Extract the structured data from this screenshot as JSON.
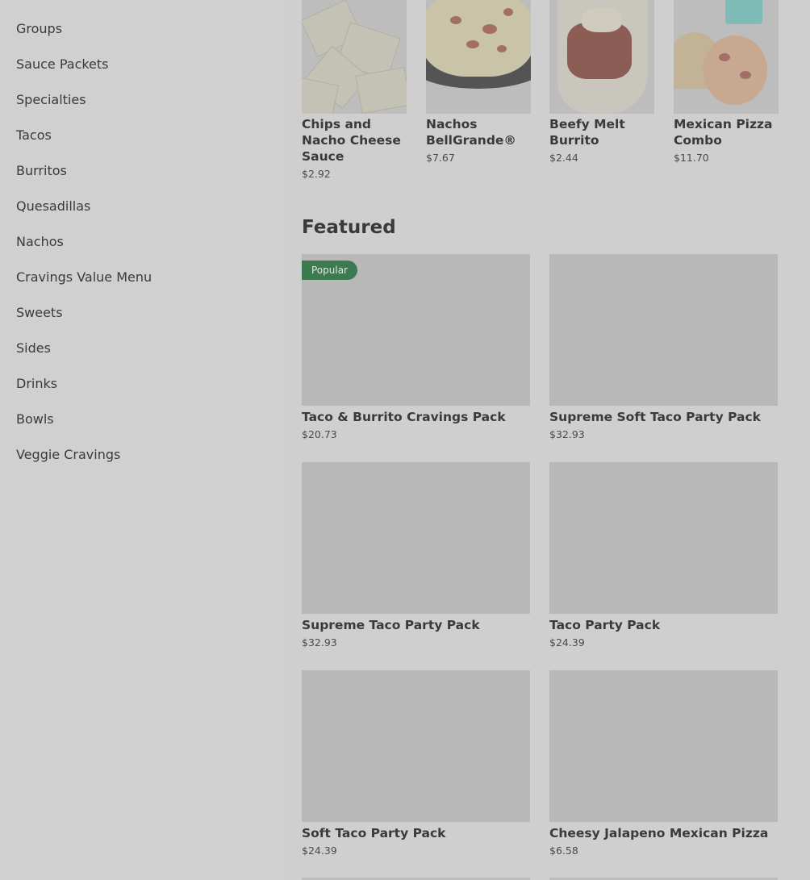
{
  "sidebar": {
    "items": [
      {
        "label": "Groups"
      },
      {
        "label": "Sauce Packets"
      },
      {
        "label": "Specialties"
      },
      {
        "label": "Tacos"
      },
      {
        "label": "Burritos"
      },
      {
        "label": "Quesadillas"
      },
      {
        "label": "Nachos"
      },
      {
        "label": "Cravings Value Menu"
      },
      {
        "label": "Sweets"
      },
      {
        "label": "Sides"
      },
      {
        "label": "Drinks"
      },
      {
        "label": "Bowls"
      },
      {
        "label": "Veggie Cravings"
      }
    ]
  },
  "carousel": {
    "items": [
      {
        "name": "Chips and Nacho Cheese Sauce",
        "price": "$2.92",
        "image": "chips-nacho-cheese-image"
      },
      {
        "name": "Nachos BellGrande®",
        "price": "$7.67",
        "image": "nachos-bellgrande-image"
      },
      {
        "name": "Beefy Melt Burrito",
        "price": "$2.44",
        "image": "beefy-melt-burrito-image"
      },
      {
        "name": "Mexican Pizza Combo",
        "price": "$11.70",
        "image": "mexican-pizza-combo-image"
      }
    ]
  },
  "featured": {
    "title": "Featured",
    "items": [
      {
        "name": "Taco & Burrito Cravings Pack",
        "price": "$20.73",
        "badge": "Popular"
      },
      {
        "name": "Supreme Soft Taco Party Pack",
        "price": "$32.93"
      },
      {
        "name": "Supreme Taco Party Pack",
        "price": "$32.93"
      },
      {
        "name": "Taco Party Pack",
        "price": "$24.39"
      },
      {
        "name": "Soft Taco Party Pack",
        "price": "$24.39"
      },
      {
        "name": "Cheesy Jalapeno Mexican Pizza",
        "price": "$6.58"
      }
    ]
  },
  "colors": {
    "overlay_background": "#cfcfcf",
    "badge": "#3d7a52",
    "text": "#3a3a3a"
  }
}
